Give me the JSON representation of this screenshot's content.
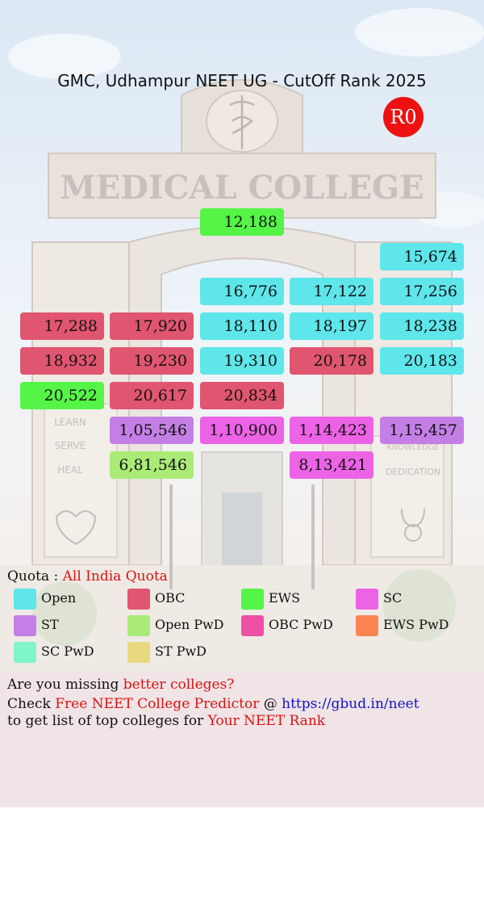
{
  "title": "GMC, Udhampur NEET UG - CutOff Rank 2025",
  "round_badge": "R0",
  "background": {
    "building_text": "MEDICAL COLLEGE",
    "left_pillar": [
      "LEARN",
      "SERVE",
      "HEAL"
    ],
    "right_pillar": [
      "KNOWLEDGE",
      "DEDICATION"
    ]
  },
  "categories": {
    "Open": "#5ee6ea",
    "OBC": "#e05570",
    "EWS": "#55f548",
    "SC": "#ec63e5",
    "ST": "#c47fe6",
    "Open PwD": "#aaeb78",
    "OBC PwD": "#ee4fa7",
    "EWS PwD": "#fb8552",
    "SC PwD": "#7ff5c8",
    "ST PwD": "#e9d97e"
  },
  "ranks": [
    {
      "value": "12,188",
      "category": "EWS"
    },
    {
      "value": "15,674",
      "category": "Open"
    },
    {
      "value": "16,776",
      "category": "Open"
    },
    {
      "value": "17,122",
      "category": "Open"
    },
    {
      "value": "17,256",
      "category": "Open"
    },
    {
      "value": "17,288",
      "category": "OBC"
    },
    {
      "value": "17,920",
      "category": "OBC"
    },
    {
      "value": "18,110",
      "category": "Open"
    },
    {
      "value": "18,197",
      "category": "Open"
    },
    {
      "value": "18,238",
      "category": "Open"
    },
    {
      "value": "18,932",
      "category": "OBC"
    },
    {
      "value": "19,230",
      "category": "OBC"
    },
    {
      "value": "19,310",
      "category": "Open"
    },
    {
      "value": "20,178",
      "category": "OBC"
    },
    {
      "value": "20,183",
      "category": "Open"
    },
    {
      "value": "20,522",
      "category": "EWS"
    },
    {
      "value": "20,617",
      "category": "OBC"
    },
    {
      "value": "20,834",
      "category": "OBC"
    },
    {
      "value": "1,05,546",
      "category": "ST"
    },
    {
      "value": "1,10,900",
      "category": "SC"
    },
    {
      "value": "1,14,423",
      "category": "SC"
    },
    {
      "value": "1,15,457",
      "category": "ST"
    },
    {
      "value": "6,81,546",
      "category": "Open PwD"
    },
    {
      "value": "8,13,421",
      "category": "SC"
    }
  ],
  "quota": {
    "label": "Quota :",
    "value": "All India Quota"
  },
  "legend": [
    {
      "label": "Open",
      "color": "#5ee6ea"
    },
    {
      "label": "OBC",
      "color": "#e05570"
    },
    {
      "label": "EWS",
      "color": "#55f548"
    },
    {
      "label": "SC",
      "color": "#ec63e5"
    },
    {
      "label": "ST",
      "color": "#c47fe6"
    },
    {
      "label": "Open PwD",
      "color": "#aaeb78"
    },
    {
      "label": "OBC PwD",
      "color": "#ee4fa7"
    },
    {
      "label": "EWS PwD",
      "color": "#fb8552"
    },
    {
      "label": "SC PwD",
      "color": "#7ff5c8"
    },
    {
      "label": "ST PwD",
      "color": "#e9d97e"
    }
  ],
  "footer": {
    "line1_prefix": "Are you missing ",
    "line1_highlight": "better colleges?",
    "line2_prefix": "Check ",
    "line2_highlight": "Free NEET College Predictor",
    "line2_at": " @ ",
    "line2_link": "https://gbud.in/neet",
    "line3_prefix": "to get list of top colleges for ",
    "line3_highlight": "Your NEET Rank"
  }
}
